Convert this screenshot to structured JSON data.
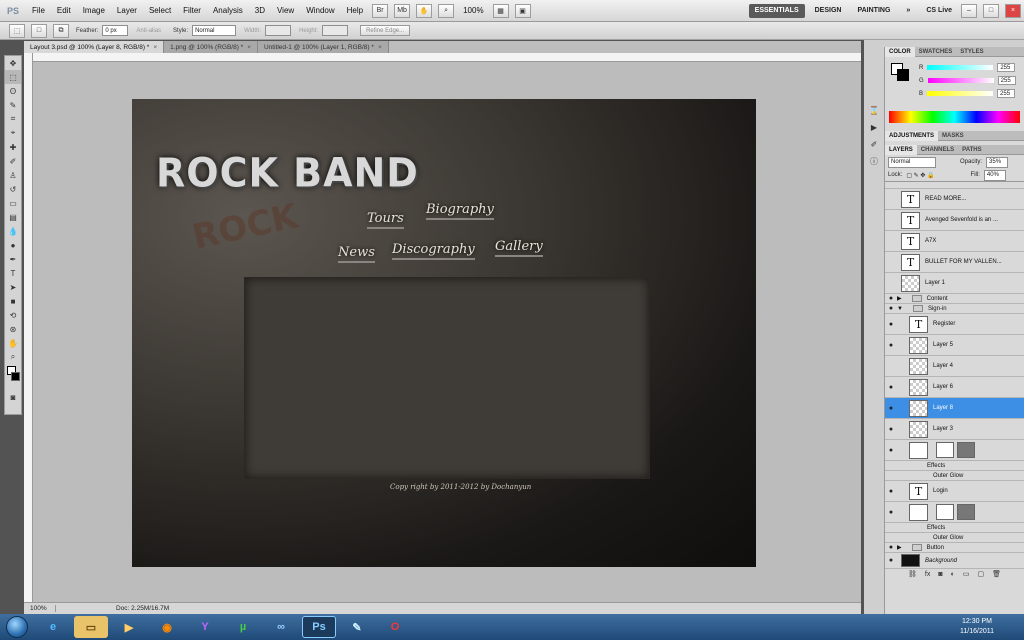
{
  "app": {
    "logo": "PS",
    "menus": [
      "File",
      "Edit",
      "Image",
      "Layer",
      "Select",
      "Filter",
      "Analysis",
      "3D",
      "View",
      "Window",
      "Help"
    ],
    "zoom": "100%",
    "workspaces": [
      "ESSENTIALS",
      "DESIGN",
      "PAINTING"
    ],
    "overflow": "»",
    "cs_live": "CS Live",
    "window_buttons": [
      "–",
      "□",
      "×"
    ]
  },
  "options": {
    "feather_label": "Feather:",
    "feather_value": "0 px",
    "anti_alias": "Anti-alias",
    "style_label": "Style:",
    "style_value": "Normal",
    "width_label": "Width:",
    "height_label": "Height:",
    "refine_edge": "Refine Edge..."
  },
  "tabs": [
    {
      "label": "Layout 3.psd @ 100% (Layer 8, RGB/8) *",
      "active": true
    },
    {
      "label": "1.png @ 100% (RGB/8) *",
      "active": false
    },
    {
      "label": "Untitled-1 @ 100% (Layer 1, RGB/8) *",
      "active": false
    }
  ],
  "artwork": {
    "title": "ROCK BAND",
    "ghost": "ROCK",
    "nav": [
      "Tours",
      "Biography",
      "News",
      "Discography",
      "Gallery"
    ],
    "copyright": "Copy right by 2011-2012 by Dochanyun"
  },
  "status": {
    "zoom": "100%",
    "doc": "Doc: 2.25M/16.7M"
  },
  "color_panel": {
    "tabs": [
      "COLOR",
      "SWATCHES",
      "STYLES"
    ],
    "channels": [
      {
        "name": "R",
        "value": "255"
      },
      {
        "name": "G",
        "value": "255"
      },
      {
        "name": "B",
        "value": "255"
      }
    ]
  },
  "adjust_panel": {
    "tabs": [
      "ADJUSTMENTS",
      "MASKS"
    ]
  },
  "layers_panel": {
    "tabs": [
      "LAYERS",
      "CHANNELS",
      "PATHS"
    ],
    "blend_mode": "Normal",
    "opacity_label": "Opacity:",
    "opacity_value": "35%",
    "lock_label": "Lock:",
    "fill_label": "Fill:",
    "fill_value": "40%",
    "layers": [
      {
        "name": "READ MORE...",
        "type": "text"
      },
      {
        "name": "Avenged Sevenfold is an ...",
        "type": "text"
      },
      {
        "name": "A7X",
        "type": "text"
      },
      {
        "name": "BULLET FOR MY VALLEN...",
        "type": "text"
      },
      {
        "name": "Layer 1",
        "type": "pixel"
      },
      {
        "name": "Content",
        "type": "group"
      },
      {
        "name": "Sign-in",
        "type": "group"
      },
      {
        "name": "Register",
        "type": "text"
      },
      {
        "name": "Layer 5",
        "type": "pixel"
      },
      {
        "name": "Layer 4",
        "type": "pixel"
      },
      {
        "name": "Layer 6",
        "type": "pixel"
      },
      {
        "name": "Layer 8",
        "type": "pixel",
        "selected": true
      },
      {
        "name": "Layer 3",
        "type": "pixel"
      },
      {
        "name": "Effects",
        "type": "effect"
      },
      {
        "name": "Outer Glow",
        "type": "effect"
      },
      {
        "name": "Login",
        "type": "text"
      },
      {
        "name": "Effects",
        "type": "effect"
      },
      {
        "name": "Outer Glow",
        "type": "effect"
      },
      {
        "name": "Button",
        "type": "group"
      },
      {
        "name": "Background",
        "type": "pixel"
      }
    ]
  },
  "taskbar": {
    "time": "12:30 PM",
    "date": "11/16/2011"
  },
  "colors": {
    "selected_layer": "#3d8ee5",
    "menu_active": "#5a5a5a"
  }
}
